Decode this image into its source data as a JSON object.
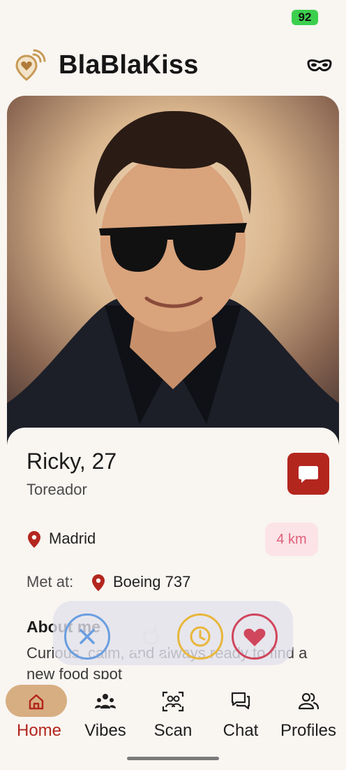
{
  "status_bar": {
    "battery": "92"
  },
  "header": {
    "app_title": "BlaBlaKiss",
    "logo_icon": "heart-pin-signal-icon",
    "mask_icon": "mask-icon"
  },
  "profile": {
    "name": "Ricky, 27",
    "occupation": "Toreador",
    "location": "Madrid",
    "distance": "4 km",
    "met_at_label": "Met at:",
    "met_at_value": "Boeing 737",
    "about_title": "About me",
    "about_text": "Curious, calm, and always ready to find a new food spot"
  },
  "actions": [
    "pass",
    "rewind",
    "later",
    "like"
  ],
  "nav": {
    "items": [
      {
        "label": "Home",
        "icon": "home-icon",
        "active": true
      },
      {
        "label": "Vibes",
        "icon": "group-icon",
        "active": false
      },
      {
        "label": "Scan",
        "icon": "scan-people-icon",
        "active": false
      },
      {
        "label": "Chat",
        "icon": "chat-icon",
        "active": false
      },
      {
        "label": "Profiles",
        "icon": "profiles-icon",
        "active": false
      }
    ]
  },
  "colors": {
    "accent": "#b3261e",
    "nav_active_bg": "#d7ae82",
    "like": "#d0465c",
    "pass": "#6a9ee0",
    "later": "#e8b63a"
  }
}
